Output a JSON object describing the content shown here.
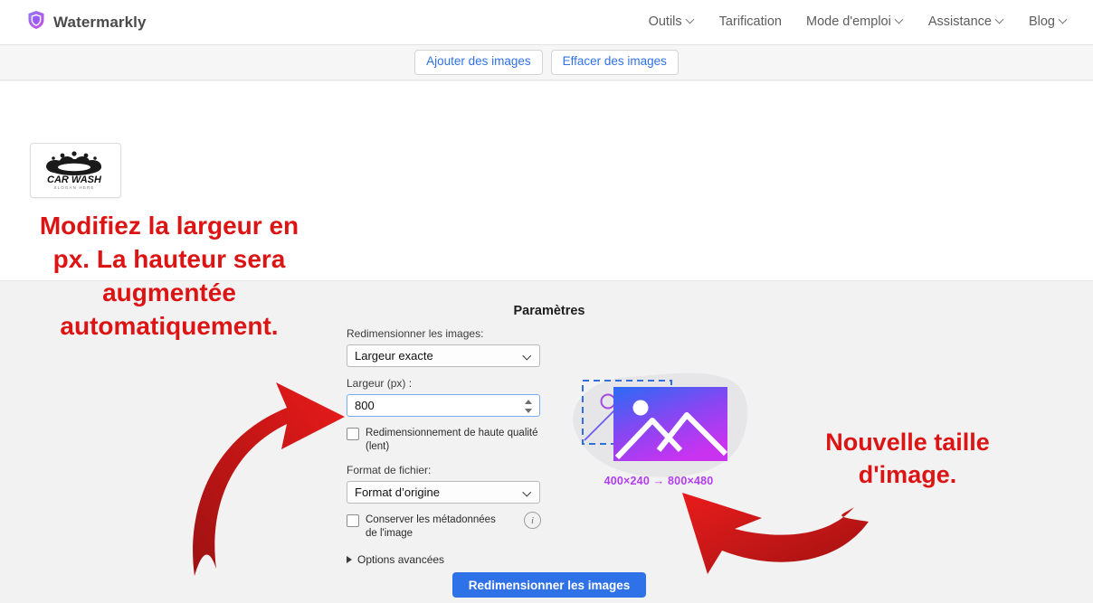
{
  "header": {
    "brand": "Watermarkly",
    "logo_icon": "shield-icon",
    "nav": [
      {
        "label": "Outils",
        "has_caret": true
      },
      {
        "label": "Tarification",
        "has_caret": false
      },
      {
        "label": "Mode d'emploi",
        "has_caret": true
      },
      {
        "label": "Assistance",
        "has_caret": true
      },
      {
        "label": "Blog",
        "has_caret": true
      }
    ]
  },
  "toolbar": {
    "add_images": "Ajouter des images",
    "clear_images": "Effacer des images"
  },
  "thumbnail": {
    "alt": "CAR WASH",
    "line1": "CAR WASH",
    "line2": "SLOGAN HERE"
  },
  "annotations": {
    "left": "Modifiez la largeur en px. La hauteur sera augmentée automatiquement.",
    "right": "Nouvelle taille d'image.",
    "color": "#dd1414"
  },
  "settings": {
    "title": "Paramètres",
    "resize_label": "Redimensionner les images:",
    "resize_value": "Largeur exacte",
    "width_label": "Largeur (px) :",
    "width_value": "800",
    "hq_checkbox_label": "Redimensionnement de haute qualité (lent)",
    "hq_checked": false,
    "format_label": "Format de fichier:",
    "format_value": "Format d’origine",
    "metadata_checkbox_label": "Conserver les métadonnées de l'image",
    "metadata_checked": false,
    "info_icon": "info-icon",
    "advanced_label": "Options avancées"
  },
  "preview": {
    "size_text": "400×240 → 800×480",
    "size_color": "#b23df0",
    "original": "400×240",
    "resized": "800×480"
  },
  "action": {
    "resize_button": "Redimensionner les images",
    "accent": "#2f72e8"
  }
}
